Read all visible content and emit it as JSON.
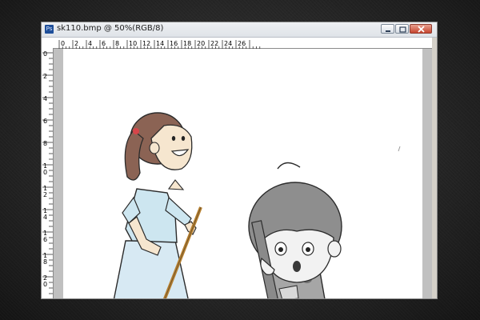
{
  "window": {
    "title": "sk110.bmp @ 50%(RGB/8)",
    "app_icon_text": "Ps"
  },
  "rulers": {
    "top_labels": [
      "0",
      "2",
      "4",
      "6",
      "8",
      "10",
      "12",
      "14",
      "16",
      "18",
      "20",
      "22",
      "24",
      "26"
    ],
    "left_labels": [
      "0",
      "2",
      "4",
      "6",
      "8",
      "10",
      "12",
      "14",
      "16",
      "18",
      "20"
    ]
  },
  "colors": {
    "background": "#262626",
    "window_chrome": "#d4d0c8",
    "close_button": "#c6452f",
    "canvas": "#ffffff"
  }
}
